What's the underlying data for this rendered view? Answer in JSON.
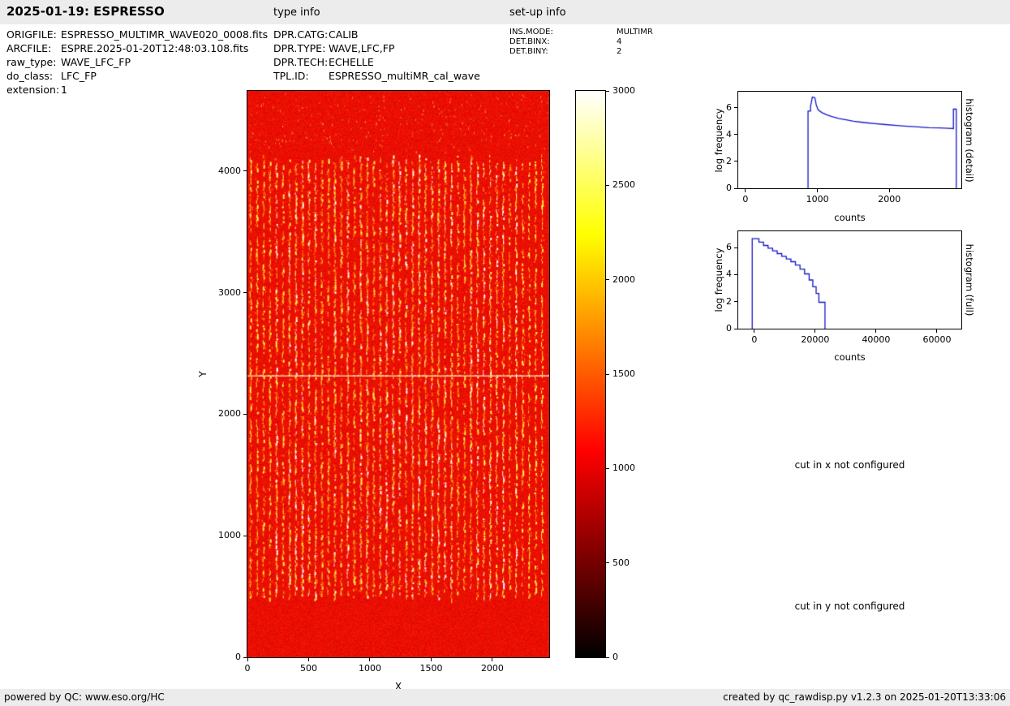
{
  "header": {
    "title": "2025-01-19: ESPRESSO",
    "type_info_label": "type info",
    "setup_info_label": "set-up info"
  },
  "metadata": {
    "left": [
      {
        "label": "ORIGFILE:",
        "value": "ESPRESSO_MULTIMR_WAVE020_0008.fits"
      },
      {
        "label": "ARCFILE:",
        "value": "ESPRE.2025-01-20T12:48:03.108.fits"
      },
      {
        "label": "raw_type:",
        "value": "WAVE_LFC_FP"
      },
      {
        "label": "do_class:",
        "value": "LFC_FP"
      },
      {
        "label": "extension:",
        "value": "1"
      }
    ],
    "middle": [
      {
        "label": "DPR.CATG:",
        "value": "CALIB"
      },
      {
        "label": "DPR.TYPE:",
        "value": "WAVE,LFC,FP"
      },
      {
        "label": "DPR.TECH:",
        "value": "ECHELLE"
      },
      {
        "label": "TPL.ID:",
        "value": "ESPRESSO_multiMR_cal_wave"
      }
    ],
    "right": [
      {
        "label": "INS.MODE:",
        "value": "MULTIMR"
      },
      {
        "label": "DET.BINX:",
        "value": "4"
      },
      {
        "label": "DET.BINY:",
        "value": "2"
      }
    ]
  },
  "notes": {
    "cut_x": "cut in x not configured",
    "cut_y": "cut in y not configured"
  },
  "footer": {
    "left": "powered by QC: www.eso.org/HC",
    "right": "created by qc_rawdisp.py v1.2.3 on 2025-01-20T13:33:06"
  },
  "chart_data": [
    {
      "id": "raw_image",
      "type": "heatmap",
      "description": "ESPRESSO raw echelle calibration frame (WAVE,LFC,FP): bright red background (counts ~1000) with ~46 vertical dashed echelle-order traces in yellow/orange/white between y=500 and y=4100, a bright horizontal detector line at y=2320, sparse bright speckles above y=4100",
      "xlabel": "X",
      "ylabel": "Y",
      "xlim": [
        0,
        2464
      ],
      "ylim": [
        0,
        4660
      ],
      "xticks": [
        0,
        500,
        1000,
        1500,
        2000
      ],
      "yticks": [
        0,
        1000,
        2000,
        3000,
        4000
      ],
      "background_value": 1050,
      "stripes": {
        "count": 46,
        "x_start": 25,
        "x_end": 2405,
        "y_start": 500,
        "y_end": 4100
      },
      "horizontal_line_y": 2320,
      "colorbar": {
        "min": 0,
        "max": 3000,
        "ticks": [
          0,
          500,
          1000,
          1500,
          2000,
          2500,
          3000
        ],
        "colormap": "hot",
        "stops": [
          "#000000",
          "#8c0000",
          "#ff0000",
          "#ff7c00",
          "#ffff00",
          "#ffffff"
        ]
      }
    },
    {
      "id": "histogram_detail",
      "type": "line",
      "title": "histogram (detail)",
      "xlabel": "counts",
      "ylabel": "log frequency",
      "color": "#1515c8",
      "xlim": [
        -100,
        3000
      ],
      "ylim": [
        0,
        7.2
      ],
      "xticks": [
        0,
        1000,
        2000
      ],
      "yticks": [
        0,
        2,
        4,
        6
      ],
      "points": [
        [
          870,
          0
        ],
        [
          870,
          5.75
        ],
        [
          905,
          5.75
        ],
        [
          905,
          6.1
        ],
        [
          930,
          6.8
        ],
        [
          965,
          6.75
        ],
        [
          985,
          6.2
        ],
        [
          1010,
          5.85
        ],
        [
          1060,
          5.65
        ],
        [
          1120,
          5.5
        ],
        [
          1200,
          5.35
        ],
        [
          1300,
          5.2
        ],
        [
          1400,
          5.1
        ],
        [
          1500,
          5.0
        ],
        [
          1650,
          4.9
        ],
        [
          1800,
          4.82
        ],
        [
          1950,
          4.75
        ],
        [
          2100,
          4.68
        ],
        [
          2250,
          4.62
        ],
        [
          2400,
          4.57
        ],
        [
          2550,
          4.52
        ],
        [
          2700,
          4.5
        ],
        [
          2820,
          4.47
        ],
        [
          2890,
          4.45
        ],
        [
          2890,
          5.9
        ],
        [
          2930,
          5.9
        ],
        [
          2930,
          0
        ]
      ]
    },
    {
      "id": "histogram_full",
      "type": "line",
      "title": "histogram (full)",
      "xlabel": "counts",
      "ylabel": "log frequency",
      "color": "#1515c8",
      "xlim": [
        -5300,
        68000
      ],
      "ylim": [
        0,
        7.2
      ],
      "xticks": [
        0,
        20000,
        40000,
        60000
      ],
      "yticks": [
        0,
        2,
        4,
        6
      ],
      "points": [
        [
          -700,
          0
        ],
        [
          -700,
          6.65
        ],
        [
          1500,
          6.65
        ],
        [
          1500,
          6.4
        ],
        [
          3000,
          6.4
        ],
        [
          3000,
          6.15
        ],
        [
          4500,
          6.15
        ],
        [
          4500,
          5.95
        ],
        [
          6000,
          5.95
        ],
        [
          6000,
          5.75
        ],
        [
          7500,
          5.75
        ],
        [
          7500,
          5.55
        ],
        [
          9000,
          5.55
        ],
        [
          9000,
          5.35
        ],
        [
          10500,
          5.35
        ],
        [
          10500,
          5.15
        ],
        [
          12000,
          5.15
        ],
        [
          12000,
          4.95
        ],
        [
          13500,
          4.95
        ],
        [
          13500,
          4.7
        ],
        [
          15000,
          4.7
        ],
        [
          15000,
          4.4
        ],
        [
          16500,
          4.4
        ],
        [
          16500,
          4.05
        ],
        [
          18000,
          4.05
        ],
        [
          18000,
          3.6
        ],
        [
          19200,
          3.6
        ],
        [
          19200,
          3.1
        ],
        [
          20300,
          3.1
        ],
        [
          20300,
          2.6
        ],
        [
          21200,
          2.6
        ],
        [
          21200,
          1.95
        ],
        [
          23200,
          1.95
        ],
        [
          23200,
          0
        ]
      ]
    }
  ]
}
